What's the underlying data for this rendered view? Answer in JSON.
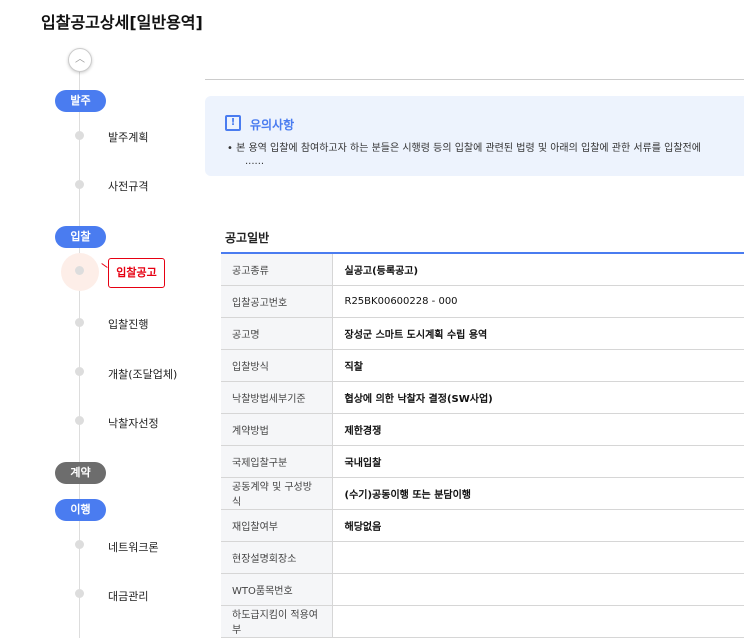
{
  "page_title": "입찰공고상세[일반용역]",
  "timeline": {
    "up_icon": "chevron-up-icon",
    "phases": {
      "order": "발주",
      "bid": "입찰",
      "contract": "계약",
      "perform": "이행"
    },
    "steps": {
      "order_plan": "발주계획",
      "pre_spec": "사전규격",
      "bid_notice": "입찰공고",
      "bid_progress": "입찰진행",
      "opening": "개찰(조달업체)",
      "winner": "낙찰자선정",
      "network": "네트워크론",
      "payment": "대금관리"
    }
  },
  "notice": {
    "title": "유의사항",
    "body": "• 본 용역 입찰에 참여하고자 하는 분들은 시행령 등의 입찰에 관련된 법령 및 아래의 입찰에 관한 서류를 입찰전에",
    "more": "......"
  },
  "section_title": "공고일반",
  "rows": [
    {
      "label": "공고종류",
      "value": "실공고(등록공고)"
    },
    {
      "label": "입찰공고번호",
      "value": "R25BK00600228 - 000"
    },
    {
      "label": "공고명",
      "value": "장성군 스마트 도시계획 수립 용역"
    },
    {
      "label": "입찰방식",
      "value": "직찰"
    },
    {
      "label": "낙찰방법세부기준",
      "value": "협상에 의한 낙찰자 결정(SW사업)"
    },
    {
      "label": "계약방법",
      "value": "제한경쟁"
    },
    {
      "label": "국제입찰구분",
      "value": "국내입찰"
    },
    {
      "label": "공동계약 및 구성방식",
      "value": "(수기)공동이행 또는 분담이행"
    },
    {
      "label": "재입찰여부",
      "value": "해당없음"
    },
    {
      "label": "현장설명회장소",
      "value": ""
    },
    {
      "label": "WTO품목번호",
      "value": ""
    },
    {
      "label": "하도급지킴이 적용여부",
      "value": ""
    }
  ]
}
